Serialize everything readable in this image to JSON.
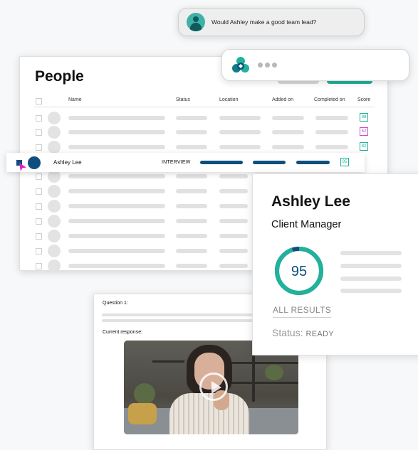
{
  "chat": {
    "user_message": "Would Ashley make a good team lead?",
    "bot_icon": "sparkle-logo-icon",
    "user_icon": "person-icon"
  },
  "people": {
    "title": "People",
    "columns": [
      "Name",
      "Status",
      "Location",
      "Added on",
      "Completed on",
      "Score"
    ],
    "scores_top": [
      {
        "value": "98",
        "color": "#20b29a"
      },
      {
        "value": "62",
        "color": "#c84fcf"
      },
      {
        "value": "82",
        "color": "#20b29a"
      }
    ],
    "selected_row": {
      "name": "Ashley Lee",
      "status": "INTERVIEW",
      "score": "95",
      "score_color": "#20b29a"
    }
  },
  "detail": {
    "name": "Ashley Lee",
    "role": "Client Manager",
    "score": "95",
    "score_fraction": 0.95,
    "all_results": "ALL RESULTS",
    "status_label": "Status:",
    "status_value": "READY"
  },
  "question": {
    "label": "Question 1:",
    "current_response": "Current response:"
  },
  "colors": {
    "accent_teal": "#20b29a",
    "navy": "#0e4f7d",
    "cursor": "#e01fc8"
  }
}
